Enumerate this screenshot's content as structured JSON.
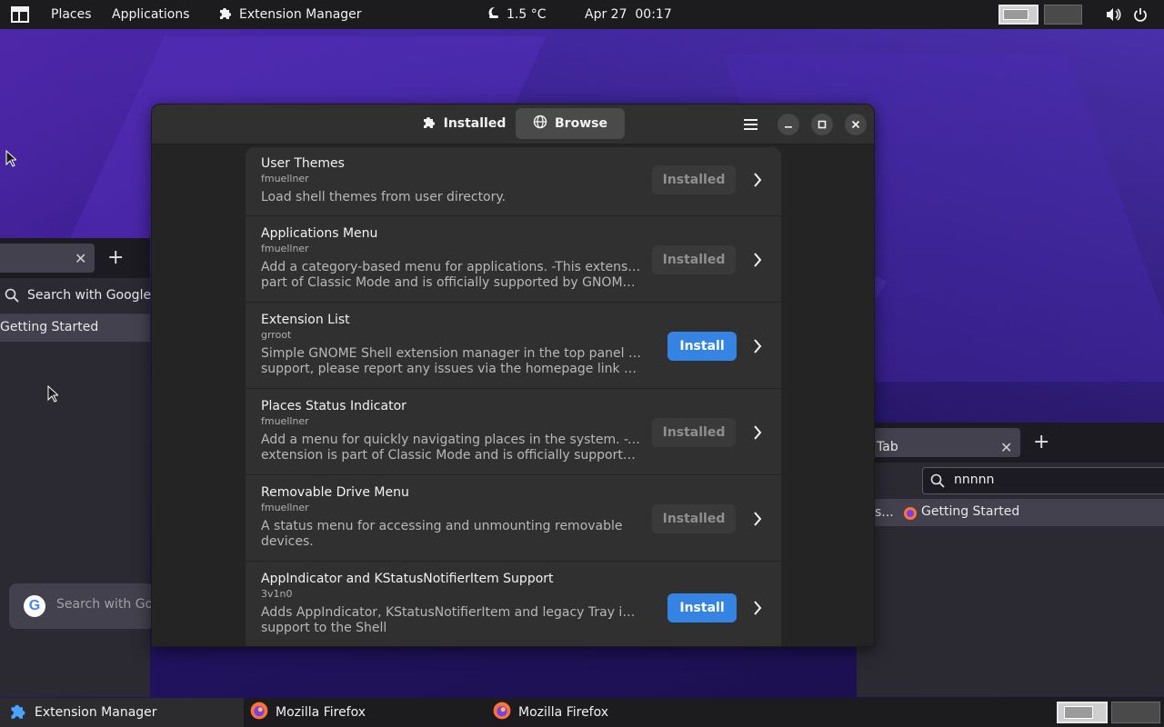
{
  "topbar": {
    "places": "Places",
    "applications": "Applications",
    "active_app": "Extension Manager",
    "weather": "1.5 °C",
    "datetime": "Apr 27  00:17",
    "icons": [
      "window-layout-icon",
      "puzzle-icon",
      "night-weather-icon",
      "workspace-1",
      "workspace-2",
      "volume-icon",
      "power-icon"
    ]
  },
  "firefox_left": {
    "search_placeholder": "Search with Google",
    "bookmark": "Getting Started",
    "google_search": "Search with Go"
  },
  "firefox_right": {
    "tab_label": "Tab",
    "url_text": "nnnnn",
    "bookmark_overflow": "s...",
    "bookmark": "Getting Started"
  },
  "window": {
    "tabs": {
      "installed": "Installed",
      "browse": "Browse"
    },
    "active_tab": "Browse",
    "extensions": [
      {
        "name": "User Themes",
        "author": "fmuellner",
        "desc": [
          "Load shell themes from user directory."
        ],
        "action": "Installed"
      },
      {
        "name": "Applications Menu",
        "author": "fmuellner",
        "desc": [
          "Add a category-based menu for applications. -This extension is",
          "part of Classic Mode and is officially supported by GNOME. Pl..."
        ],
        "action": "Installed"
      },
      {
        "name": "Extension List",
        "author": "grroot",
        "desc": [
          "Simple GNOME Shell extension manager in the top panel -:-For",
          "support, please report any issues via the homepage link below."
        ],
        "action": "Install"
      },
      {
        "name": "Places Status Indicator",
        "author": "fmuellner",
        "desc": [
          "Add a menu for quickly navigating places in the system. -This",
          "extension is part of Classic Mode and is officially supported by..."
        ],
        "action": "Installed"
      },
      {
        "name": "Removable Drive Menu",
        "author": "fmuellner",
        "desc": [
          "A status menu for accessing and unmounting removable",
          "devices."
        ],
        "action": "Installed"
      },
      {
        "name": "AppIndicator and KStatusNotifierItem Support",
        "author": "3v1n0",
        "desc": [
          "Adds AppIndicator, KStatusNotifierItem and legacy Tray icons",
          "support to the Shell"
        ],
        "action": "Install"
      }
    ]
  },
  "bottombar": {
    "tasks": [
      "Extension Manager",
      "Mozilla Firefox",
      "Mozilla Firefox"
    ]
  },
  "colors": {
    "accent": "#3584e4",
    "window_bg": "#242424",
    "row_bg": "#303030",
    "panel_bg": "#1c1c1e"
  }
}
